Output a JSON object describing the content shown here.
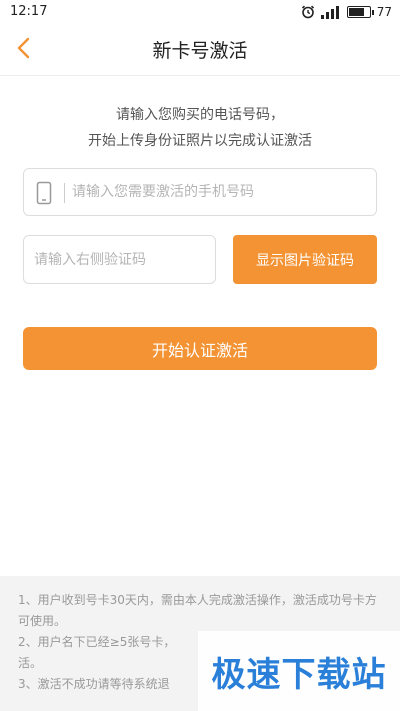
{
  "status_bar": {
    "time": "12:17",
    "battery_level": "77",
    "battery_fraction": 0.77
  },
  "header": {
    "title": "新卡号激活",
    "back_icon": "chevron-left-icon"
  },
  "intro": {
    "line1": "请输入您购买的电话号码，",
    "line2": "开始上传身份证照片以完成认证激活"
  },
  "form": {
    "phone_placeholder": "请输入您需要激活的手机号码",
    "phone_value": "",
    "captcha_placeholder": "请输入右侧验证码",
    "captcha_value": "",
    "show_captcha_label": "显示图片验证码",
    "activate_label": "开始认证激活"
  },
  "notes": [
    "1、用户收到号卡30天内，需由本人完成激活操作，激活成功号卡方可使用。",
    "2、用户名下已经≥5张号卡，",
    "活。",
    "3、激活不成功请等待系统退"
  ],
  "watermark": "极速下载站",
  "colors": {
    "accent": "#f39334",
    "back_arrow": "#f39334",
    "watermark": "#2a7fd8"
  }
}
